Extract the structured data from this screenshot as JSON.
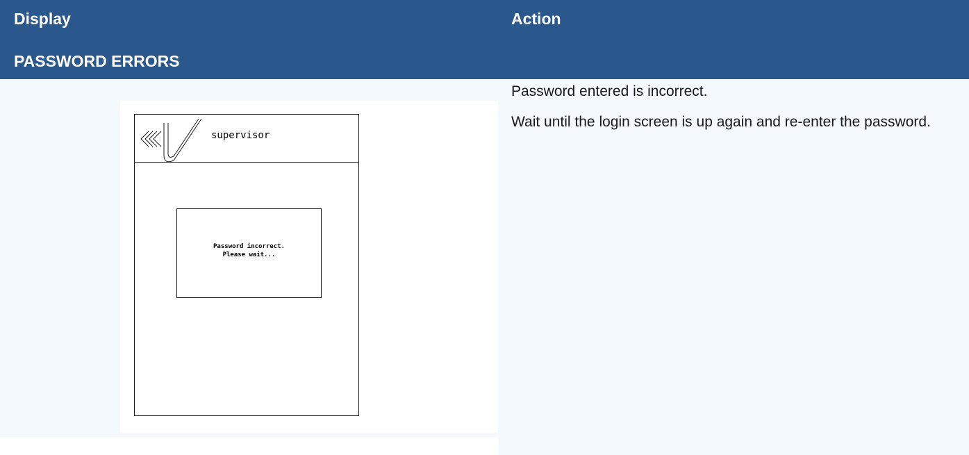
{
  "header": {
    "display_label": "Display",
    "action_label": "Action"
  },
  "section": {
    "title": "PASSWORD ERRORS"
  },
  "action": {
    "line_1": "Password entered is incorrect.",
    "line_2": "Wait until the login screen is up again and re-enter the password."
  },
  "screen": {
    "user_name": "supervisor",
    "logo_icon": "chevron-v-logo-icon",
    "dialog": {
      "line_1": "Password incorrect.",
      "line_2": "Please wait..."
    }
  },
  "colors": {
    "header_bg": "#2a578c",
    "header_text": "#ffffff",
    "cell_bg": "#f3f9fd",
    "body_text": "#1a1a1a"
  }
}
